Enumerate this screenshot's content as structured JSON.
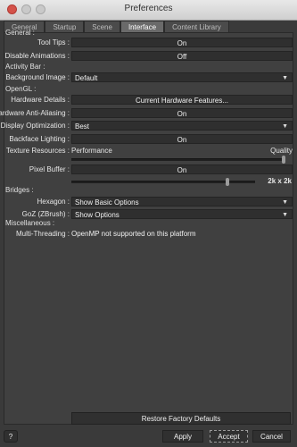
{
  "window": {
    "title": "Preferences"
  },
  "tabs": [
    {
      "label": "General"
    },
    {
      "label": "Startup"
    },
    {
      "label": "Scene"
    },
    {
      "label": "Interface"
    },
    {
      "label": "Content Library"
    }
  ],
  "active_tab": "Interface",
  "sections": {
    "general": "General :",
    "activity_bar": "Activity Bar :",
    "opengl": "OpenGL :",
    "bridges": "Bridges :",
    "misc": "Miscellaneous :"
  },
  "general": {
    "tool_tips": {
      "label": "Tool Tips :",
      "value": "On"
    },
    "disable_animations": {
      "label": "Disable Animations :",
      "value": "Off"
    }
  },
  "activity_bar": {
    "background_image": {
      "label": "Background Image :",
      "value": "Default"
    }
  },
  "opengl": {
    "hardware_details": {
      "label": "Hardware Details :",
      "value": "Current Hardware Features..."
    },
    "anti_aliasing": {
      "label": "Hardware Anti-Aliasing :",
      "value": "On"
    },
    "display_optimization": {
      "label": "Display Optimization :",
      "value": "Best"
    },
    "backface_lighting": {
      "label": "Backface Lighting :",
      "value": "On"
    },
    "texture_resources": {
      "label": "Texture Resources :",
      "min_label": "Performance",
      "max_label": "Quality",
      "level": 1.0
    },
    "pixel_buffer": {
      "label": "Pixel Buffer :",
      "value": "On",
      "size": "2k x 2k",
      "level": 0.85
    }
  },
  "bridges": {
    "hexagon": {
      "label": "Hexagon :",
      "value": "Show Basic Options"
    },
    "goz": {
      "label": "GoZ (ZBrush) :",
      "value": "Show Options"
    }
  },
  "misc": {
    "multithreading": {
      "label": "Multi-Threading :",
      "value": "OpenMP not supported on this platform"
    }
  },
  "buttons": {
    "restore": "Restore Factory Defaults",
    "apply": "Apply",
    "accept": "Accept",
    "cancel": "Cancel",
    "help": "?"
  },
  "icons": {
    "dropdown": "chevron-down-icon"
  }
}
